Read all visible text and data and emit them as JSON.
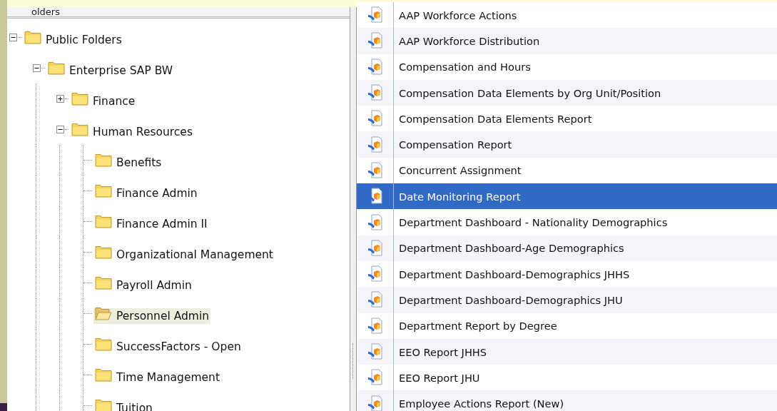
{
  "tree_panel": {
    "header": "olders"
  },
  "tree": [
    {
      "label": "Public Folders",
      "expanded": true,
      "selected": false,
      "children": [
        {
          "label": "Enterprise SAP BW",
          "expanded": true,
          "selected": false,
          "children": [
            {
              "label": "Finance",
              "expanded": false,
              "selected": false
            },
            {
              "label": "Human Resources",
              "expanded": true,
              "selected": false,
              "children": [
                {
                  "label": "Benefits",
                  "selected": false
                },
                {
                  "label": "Finance Admin",
                  "selected": false
                },
                {
                  "label": "Finance Admin II",
                  "selected": false
                },
                {
                  "label": "Organizational Management",
                  "selected": false
                },
                {
                  "label": "Payroll Admin",
                  "selected": false
                },
                {
                  "label": "Personnel Admin",
                  "selected": true
                },
                {
                  "label": "SuccessFactors - Open",
                  "selected": false
                },
                {
                  "label": "Time Management",
                  "selected": false
                },
                {
                  "label": "Tuition",
                  "selected": false
                }
              ]
            }
          ]
        }
      ]
    }
  ],
  "reports": [
    {
      "label": "AAP Workforce Actions",
      "selected": false
    },
    {
      "label": "AAP Workforce Distribution",
      "selected": false
    },
    {
      "label": "Compensation and Hours",
      "selected": false
    },
    {
      "label": "Compensation Data Elements by Org Unit/Position",
      "selected": false
    },
    {
      "label": "Compensation Data Elements Report",
      "selected": false
    },
    {
      "label": "Compensation Report",
      "selected": false
    },
    {
      "label": "Concurrent Assignment",
      "selected": false
    },
    {
      "label": "Date Monitoring Report",
      "selected": true
    },
    {
      "label": "Department Dashboard - Nationality Demographics",
      "selected": false
    },
    {
      "label": "Department Dashboard-Age Demographics",
      "selected": false
    },
    {
      "label": "Department Dashboard-Demographics JHHS",
      "selected": false
    },
    {
      "label": "Department Dashboard-Demographics JHU",
      "selected": false
    },
    {
      "label": "Department Report by Degree",
      "selected": false
    },
    {
      "label": "EEO Report JHHS",
      "selected": false
    },
    {
      "label": "EEO Report JHU",
      "selected": false
    },
    {
      "label": "Employee Actions Report (New)",
      "selected": false
    }
  ]
}
